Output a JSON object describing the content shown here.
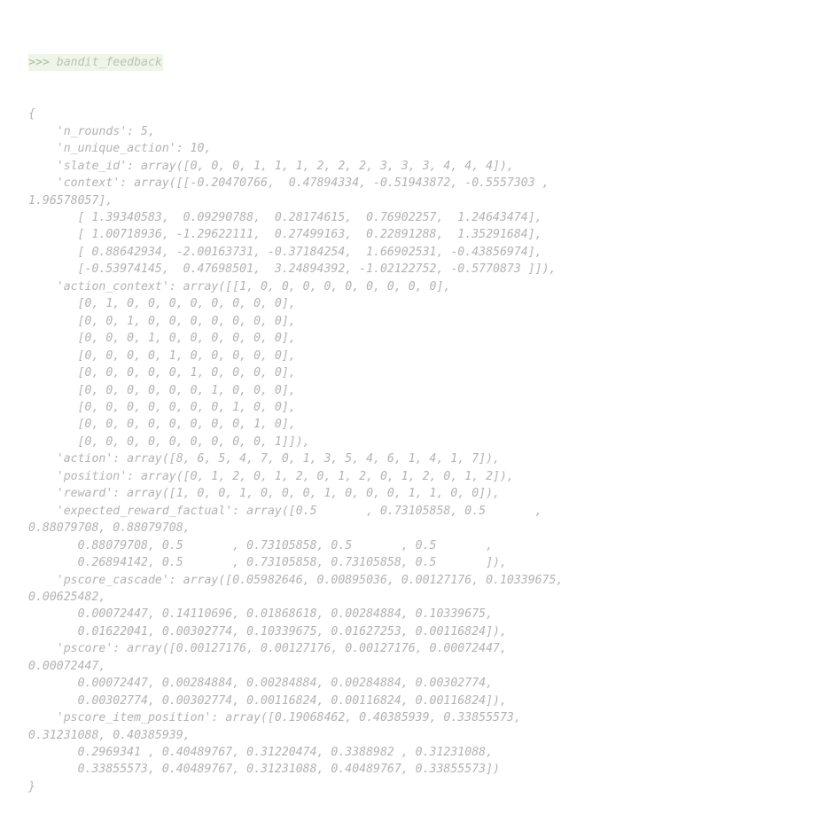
{
  "window": {
    "kind": "python-repl-output",
    "title": "bandit_feedback"
  },
  "theme": {
    "background": "#ffffff",
    "text_color": "#b3b3b3",
    "prompt_highlight_background": "#eef5e9",
    "prompt_color": "#a9bba2"
  },
  "prompt": {
    "symbol": ">>>",
    "expression": " bandit_feedback"
  },
  "output_lines": [
    "{",
    "    'n_rounds': 5,",
    "    'n_unique_action': 10,",
    "    'slate_id': array([0, 0, 0, 1, 1, 1, 2, 2, 2, 3, 3, 3, 4, 4, 4]),",
    "    'context': array([[-0.20470766,  0.47894334, -0.51943872, -0.5557303 ,",
    "1.96578057],",
    "       [ 1.39340583,  0.09290788,  0.28174615,  0.76902257,  1.24643474],",
    "       [ 1.00718936, -1.29622111,  0.27499163,  0.22891288,  1.35291684],",
    "       [ 0.88642934, -2.00163731, -0.37184254,  1.66902531, -0.43856974],",
    "       [-0.53974145,  0.47698501,  3.24894392, -1.02122752, -0.5770873 ]]),",
    "    'action_context': array([[1, 0, 0, 0, 0, 0, 0, 0, 0, 0],",
    "       [0, 1, 0, 0, 0, 0, 0, 0, 0, 0],",
    "       [0, 0, 1, 0, 0, 0, 0, 0, 0, 0],",
    "       [0, 0, 0, 1, 0, 0, 0, 0, 0, 0],",
    "       [0, 0, 0, 0, 1, 0, 0, 0, 0, 0],",
    "       [0, 0, 0, 0, 0, 1, 0, 0, 0, 0],",
    "       [0, 0, 0, 0, 0, 0, 1, 0, 0, 0],",
    "       [0, 0, 0, 0, 0, 0, 0, 1, 0, 0],",
    "       [0, 0, 0, 0, 0, 0, 0, 0, 1, 0],",
    "       [0, 0, 0, 0, 0, 0, 0, 0, 0, 1]]),",
    "    'action': array([8, 6, 5, 4, 7, 0, 1, 3, 5, 4, 6, 1, 4, 1, 7]),",
    "    'position': array([0, 1, 2, 0, 1, 2, 0, 1, 2, 0, 1, 2, 0, 1, 2]),",
    "    'reward': array([1, 0, 0, 1, 0, 0, 0, 1, 0, 0, 0, 1, 1, 0, 0]),",
    "    'expected_reward_factual': array([0.5       , 0.73105858, 0.5       ,",
    "0.88079708, 0.88079708,",
    "       0.88079708, 0.5       , 0.73105858, 0.5       , 0.5       ,",
    "       0.26894142, 0.5       , 0.73105858, 0.73105858, 0.5       ]),",
    "    'pscore_cascade': array([0.05982646, 0.00895036, 0.00127176, 0.10339675,",
    "0.00625482,",
    "       0.00072447, 0.14110696, 0.01868618, 0.00284884, 0.10339675,",
    "       0.01622041, 0.00302774, 0.10339675, 0.01627253, 0.00116824]),",
    "    'pscore': array([0.00127176, 0.00127176, 0.00127176, 0.00072447,",
    "0.00072447,",
    "       0.00072447, 0.00284884, 0.00284884, 0.00284884, 0.00302774,",
    "       0.00302774, 0.00302774, 0.00116824, 0.00116824, 0.00116824]),",
    "    'pscore_item_position': array([0.19068462, 0.40385939, 0.33855573,",
    "0.31231088, 0.40385939,",
    "       0.2969341 , 0.40489767, 0.31220474, 0.3388982 , 0.31231088,",
    "       0.33855573, 0.40489767, 0.31231088, 0.40489767, 0.33855573])",
    "}"
  ],
  "data_summary": {
    "n_rounds": 5,
    "n_unique_action": 10,
    "slate_id": [
      0,
      0,
      0,
      1,
      1,
      1,
      2,
      2,
      2,
      3,
      3,
      3,
      4,
      4,
      4
    ],
    "context": [
      [
        -0.20470766,
        0.47894334,
        -0.51943872,
        -0.5557303,
        1.96578057
      ],
      [
        1.39340583,
        0.09290788,
        0.28174615,
        0.76902257,
        1.24643474
      ],
      [
        1.00718936,
        -1.29622111,
        0.27499163,
        0.22891288,
        1.35291684
      ],
      [
        0.88642934,
        -2.00163731,
        -0.37184254,
        1.66902531,
        -0.43856974
      ],
      [
        -0.53974145,
        0.47698501,
        3.24894392,
        -1.02122752,
        -0.5770873
      ]
    ],
    "action_context": [
      [
        1,
        0,
        0,
        0,
        0,
        0,
        0,
        0,
        0,
        0
      ],
      [
        0,
        1,
        0,
        0,
        0,
        0,
        0,
        0,
        0,
        0
      ],
      [
        0,
        0,
        1,
        0,
        0,
        0,
        0,
        0,
        0,
        0
      ],
      [
        0,
        0,
        0,
        1,
        0,
        0,
        0,
        0,
        0,
        0
      ],
      [
        0,
        0,
        0,
        0,
        1,
        0,
        0,
        0,
        0,
        0
      ],
      [
        0,
        0,
        0,
        0,
        0,
        1,
        0,
        0,
        0,
        0
      ],
      [
        0,
        0,
        0,
        0,
        0,
        0,
        1,
        0,
        0,
        0
      ],
      [
        0,
        0,
        0,
        0,
        0,
        0,
        0,
        1,
        0,
        0
      ],
      [
        0,
        0,
        0,
        0,
        0,
        0,
        0,
        0,
        1,
        0
      ],
      [
        0,
        0,
        0,
        0,
        0,
        0,
        0,
        0,
        0,
        1
      ]
    ],
    "action": [
      8,
      6,
      5,
      4,
      7,
      0,
      1,
      3,
      5,
      4,
      6,
      1,
      4,
      1,
      7
    ],
    "position": [
      0,
      1,
      2,
      0,
      1,
      2,
      0,
      1,
      2,
      0,
      1,
      2,
      0,
      1,
      2
    ],
    "reward": [
      1,
      0,
      0,
      1,
      0,
      0,
      0,
      1,
      0,
      0,
      0,
      1,
      1,
      0,
      0
    ],
    "expected_reward_factual": [
      0.5,
      0.73105858,
      0.5,
      0.88079708,
      0.88079708,
      0.88079708,
      0.5,
      0.73105858,
      0.5,
      0.5,
      0.26894142,
      0.5,
      0.73105858,
      0.73105858,
      0.5
    ],
    "pscore_cascade": [
      0.05982646,
      0.00895036,
      0.00127176,
      0.10339675,
      0.00625482,
      0.00072447,
      0.14110696,
      0.01868618,
      0.00284884,
      0.10339675,
      0.01622041,
      0.00302774,
      0.10339675,
      0.01627253,
      0.00116824
    ],
    "pscore": [
      0.00127176,
      0.00127176,
      0.00127176,
      0.00072447,
      0.00072447,
      0.00072447,
      0.00284884,
      0.00284884,
      0.00284884,
      0.00302774,
      0.00302774,
      0.00302774,
      0.00116824,
      0.00116824,
      0.00116824
    ],
    "pscore_item_position": [
      0.19068462,
      0.40385939,
      0.33855573,
      0.31231088,
      0.40385939,
      0.2969341,
      0.40489767,
      0.31220474,
      0.3388982,
      0.31231088,
      0.33855573,
      0.40489767,
      0.31231088,
      0.40489767,
      0.33855573
    ]
  }
}
